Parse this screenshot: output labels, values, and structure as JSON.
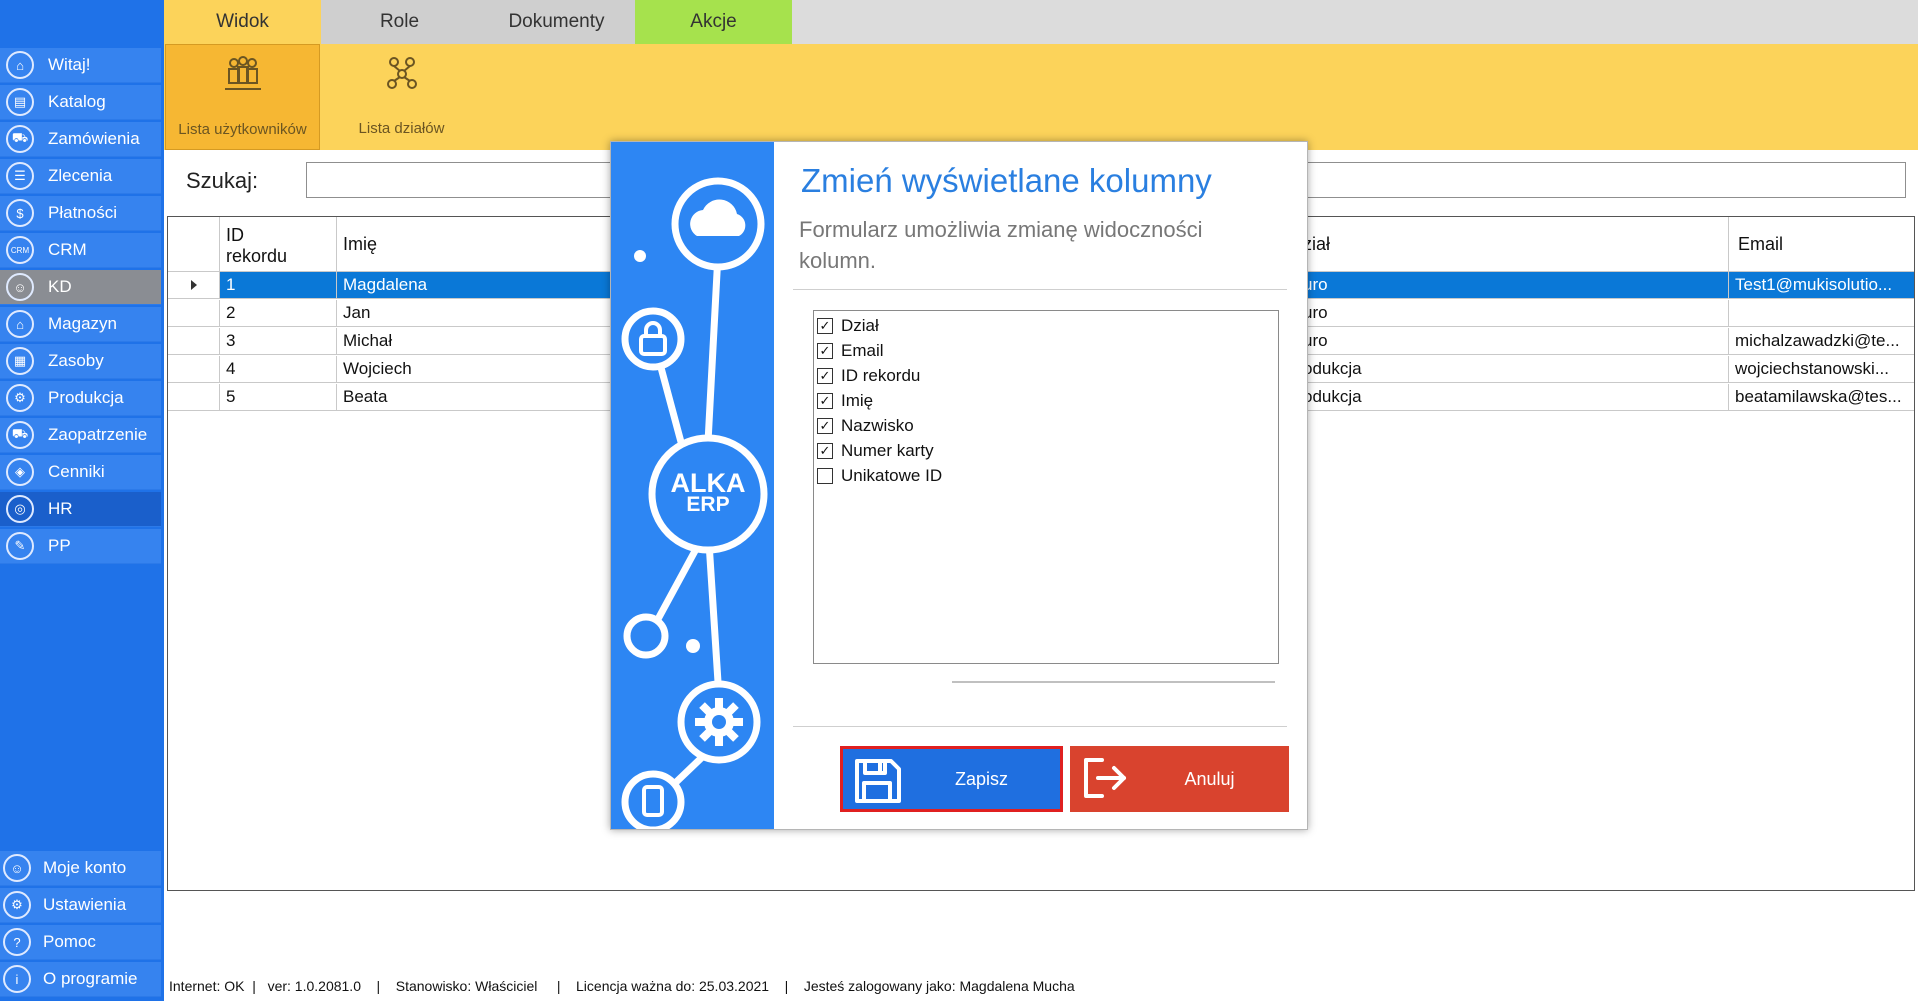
{
  "tabs": [
    {
      "label": "Widok"
    },
    {
      "label": "Role"
    },
    {
      "label": "Dokumenty"
    },
    {
      "label": "Akcje"
    }
  ],
  "ribbon": {
    "users_label": "Lista użytkowników",
    "depts_label": "Lista działów"
  },
  "sidebar": {
    "items": [
      {
        "label": "Witaj!",
        "icon": "home-icon"
      },
      {
        "label": "Katalog",
        "icon": "book-icon"
      },
      {
        "label": "Zamówienia",
        "icon": "cart-icon"
      },
      {
        "label": "Zlecenia",
        "icon": "list-icon"
      },
      {
        "label": "Płatności",
        "icon": "dollar-icon"
      },
      {
        "label": "CRM",
        "icon": "crm-icon"
      },
      {
        "label": "KD",
        "icon": "user-icon"
      },
      {
        "label": "Magazyn",
        "icon": "warehouse-icon"
      },
      {
        "label": "Zasoby",
        "icon": "resources-icon"
      },
      {
        "label": "Produkcja",
        "icon": "production-icon"
      },
      {
        "label": "Zaopatrzenie",
        "icon": "truck-icon"
      },
      {
        "label": "Cenniki",
        "icon": "tag-icon"
      },
      {
        "label": "HR",
        "icon": "hr-icon"
      },
      {
        "label": "PP",
        "icon": "pp-icon"
      }
    ],
    "bottom": [
      {
        "label": "Moje konto",
        "icon": "account-icon"
      },
      {
        "label": "Ustawienia",
        "icon": "settings-icon"
      },
      {
        "label": "Pomoc",
        "icon": "help-icon"
      },
      {
        "label": "O programie",
        "icon": "info-icon"
      }
    ]
  },
  "search": {
    "label": "Szukaj:",
    "value": ""
  },
  "grid": {
    "columns": [
      "ID\nrekordu",
      "Imię",
      "ział",
      "Email"
    ],
    "rows": [
      {
        "id": "1",
        "first": "Magdalena",
        "dept": "uro",
        "email": "Test1@mukisolutio..."
      },
      {
        "id": "2",
        "first": "Jan",
        "dept": "uro",
        "email": ""
      },
      {
        "id": "3",
        "first": "Michał",
        "dept": "uro",
        "email": "michalzawadzki@te..."
      },
      {
        "id": "4",
        "first": "Wojciech",
        "dept": "odukcja",
        "email": "wojciechstanowski..."
      },
      {
        "id": "5",
        "first": "Beata",
        "dept": "odukcja",
        "email": "beatamilawska@tes..."
      }
    ]
  },
  "modal": {
    "title": "Zmień wyświetlane kolumny",
    "description": "Formularz umożliwia zmianę widoczności kolumn.",
    "brand_line1": "ALKA",
    "brand_line2": "ERP",
    "columns": [
      {
        "label": "Dział",
        "checked": true
      },
      {
        "label": "Email",
        "checked": true
      },
      {
        "label": "ID rekordu",
        "checked": true
      },
      {
        "label": "Imię",
        "checked": true
      },
      {
        "label": "Nazwisko",
        "checked": true
      },
      {
        "label": "Numer karty",
        "checked": true
      },
      {
        "label": "Unikatowe ID",
        "checked": false
      }
    ],
    "save_label": "Zapisz",
    "cancel_label": "Anuluj"
  },
  "status": {
    "internet": "Internet: OK",
    "version": "ver: 1.0.2081.0",
    "station": "Stanowisko: Właściciel",
    "license": "Licencja ważna do: 25.03.2021",
    "user": "Jesteś zalogowany jako: Magdalena Mucha",
    "separator": "|"
  },
  "colors": {
    "sidebar": "#1f72e8",
    "ribbon": "#fcd35a",
    "akcje_tab": "#a6e24d",
    "selected_row": "#0a78d7",
    "save_button": "#1f6fe0",
    "cancel_button": "#d9432e"
  }
}
